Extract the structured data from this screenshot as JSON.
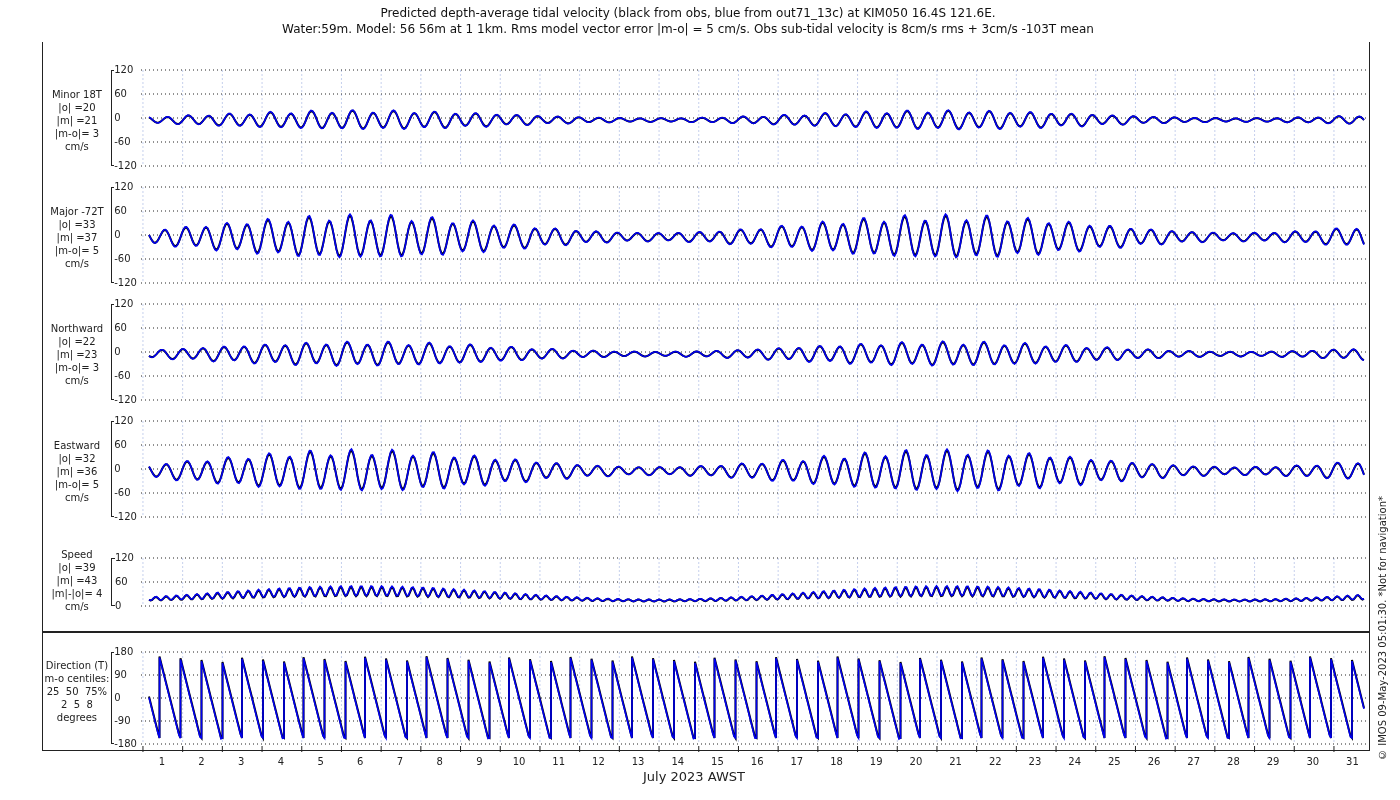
{
  "title": [
    "Predicted depth-average tidal velocity (black from obs, blue from out71_13c) at KIM050 16.4S 121.6E.",
    "Water:59m. Model: 56 56m at 1 1km. Rms model vector error |m-o| = 5 cm/s. Obs sub-tidal velocity is 8cm/s rms + 3cm/s -103T mean"
  ],
  "panels": [
    {
      "kind": "signed",
      "label": [
        "Minor 18T",
        "|o| =20",
        "|m| =21",
        "|m-o|= 3",
        "cm/s"
      ],
      "yticks": [
        "120",
        "60",
        "0",
        "-60",
        "-120"
      ]
    },
    {
      "kind": "signed",
      "label": [
        "Major -72T",
        "|o| =33",
        "|m| =37",
        "|m-o|= 5",
        "cm/s"
      ],
      "yticks": [
        "120",
        "60",
        "0",
        "-60",
        "-120"
      ]
    },
    {
      "kind": "signed",
      "label": [
        "Northward",
        "|o| =22",
        "|m| =23",
        "|m-o|= 3",
        "cm/s"
      ],
      "yticks": [
        "120",
        "60",
        "0",
        "-60",
        "-120"
      ]
    },
    {
      "kind": "signed",
      "label": [
        "Eastward",
        "|o| =32",
        "|m| =36",
        "|m-o|= 5",
        "cm/s"
      ],
      "yticks": [
        "120",
        "60",
        "0",
        "-60",
        "-120"
      ]
    },
    {
      "kind": "speed",
      "label": [
        "Speed",
        "|o| =39",
        "|m| =43",
        "|m|-|o|= 4",
        "cm/s"
      ],
      "yticks": [
        "120",
        "60",
        "0"
      ]
    },
    {
      "kind": "direction",
      "label": [
        "Direction (T)",
        "m-o centiles:",
        "25  50  75%",
        "2  5  8",
        "degrees"
      ],
      "yticks": [
        "180",
        "90",
        "0",
        "-90",
        "-180"
      ]
    }
  ],
  "x_axis": {
    "ticks": [
      "1",
      "2",
      "3",
      "4",
      "5",
      "6",
      "7",
      "8",
      "9",
      "10",
      "11",
      "12",
      "13",
      "14",
      "15",
      "16",
      "17",
      "18",
      "19",
      "20",
      "21",
      "22",
      "23",
      "24",
      "25",
      "26",
      "27",
      "28",
      "29",
      "30",
      "31"
    ],
    "label": "July 2023 AWST"
  },
  "credit": "© IMOS 09-May-2023 05:01:30. *Not for navigation*"
}
